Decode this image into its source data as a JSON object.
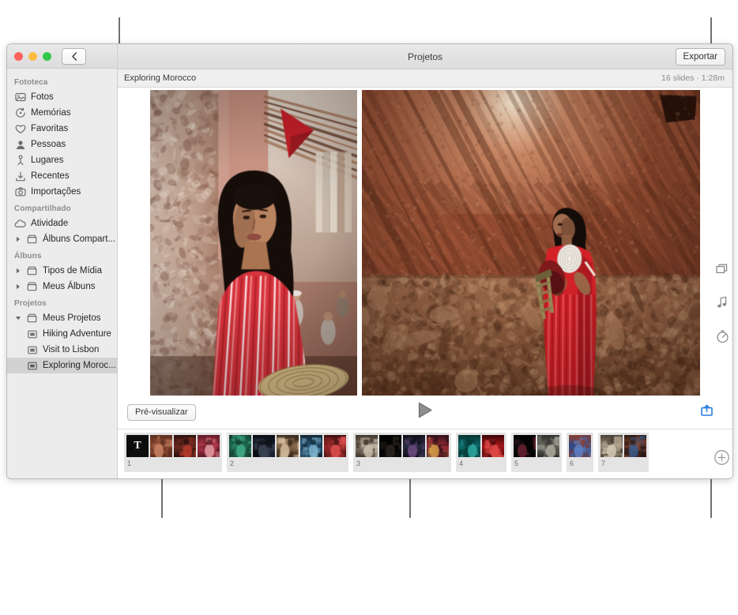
{
  "window": {
    "toolbar_title": "Projetos",
    "export_label": "Exportar",
    "back_icon": "chevron-left-icon"
  },
  "sidebar": {
    "sections": [
      {
        "header": "Fototeca",
        "items": [
          {
            "label": "Fotos",
            "icon": "photos-icon"
          },
          {
            "label": "Memórias",
            "icon": "memories-icon"
          },
          {
            "label": "Favoritas",
            "icon": "heart-icon"
          },
          {
            "label": "Pessoas",
            "icon": "person-icon"
          },
          {
            "label": "Lugares",
            "icon": "pin-icon"
          },
          {
            "label": "Recentes",
            "icon": "download-icon"
          },
          {
            "label": "Importações",
            "icon": "camera-icon"
          }
        ]
      },
      {
        "header": "Compartilhado",
        "items": [
          {
            "label": "Atividade",
            "icon": "cloud-icon"
          },
          {
            "label": "Álbuns Compart...",
            "icon": "folder-icon",
            "disclosure": "collapsed",
            "trailing_icon": "plus-circle-icon"
          }
        ]
      },
      {
        "header": "Álbuns",
        "items": [
          {
            "label": "Tipos de Mídia",
            "icon": "folder-icon",
            "disclosure": "collapsed"
          },
          {
            "label": "Meus Álbuns",
            "icon": "folder-icon",
            "disclosure": "collapsed"
          }
        ]
      },
      {
        "header": "Projetos",
        "items": [
          {
            "label": "Meus Projetos",
            "icon": "folder-icon",
            "disclosure": "expanded"
          },
          {
            "label": "Hiking Adventure",
            "icon": "slideshow-icon",
            "child": true
          },
          {
            "label": "Visit to Lisbon",
            "icon": "slideshow-icon",
            "child": true
          },
          {
            "label": "Exploring Moroc...",
            "icon": "slideshow-icon",
            "child": true,
            "selected": true
          }
        ]
      }
    ]
  },
  "project_bar": {
    "name": "Exploring Morocco",
    "meta": "16 slides · 1:28m"
  },
  "controls": {
    "preview_label": "Pré-visualizar",
    "play_icon": "play-icon",
    "share_icon": "export-share-icon"
  },
  "rail": {
    "icons": [
      {
        "name": "themes-icon"
      },
      {
        "name": "music-note-icon"
      },
      {
        "name": "duration-timer-icon"
      }
    ],
    "add_icon": "plus-circle-icon"
  },
  "filmstrip": {
    "groups": [
      {
        "number": "1",
        "slides": [
          {
            "kind": "title",
            "letter": "T"
          },
          {
            "kind": "photo",
            "palette": [
              "#8a4a33",
              "#c98263",
              "#5d2d1e"
            ]
          },
          {
            "kind": "photo",
            "palette": [
              "#6e2a22",
              "#b33a2c",
              "#2a100c"
            ]
          },
          {
            "kind": "photo",
            "palette": [
              "#b0374a",
              "#e8a0a8",
              "#5b1b27"
            ]
          }
        ]
      },
      {
        "number": "2",
        "slides": [
          {
            "kind": "photo",
            "palette": [
              "#1f6b52",
              "#3fae86",
              "#13372c"
            ]
          },
          {
            "kind": "photo",
            "palette": [
              "#1d2230",
              "#3c4556",
              "#0b0e14"
            ]
          },
          {
            "kind": "photo",
            "palette": [
              "#8a6a4a",
              "#d8c0a0",
              "#3a2a1c"
            ]
          },
          {
            "kind": "photo",
            "palette": [
              "#2a5a7a",
              "#7fb4cf",
              "#122634"
            ]
          },
          {
            "kind": "photo",
            "palette": [
              "#9a2a2a",
              "#e05050",
              "#3a0e0e"
            ]
          }
        ]
      },
      {
        "number": "3",
        "slides": [
          {
            "kind": "photo",
            "palette": [
              "#8f8070",
              "#cdbfae",
              "#3e352c"
            ]
          },
          {
            "kind": "photo",
            "palette": [
              "#101010",
              "#2a2420",
              "#000000"
            ]
          },
          {
            "kind": "photo",
            "palette": [
              "#2a2a40",
              "#6a4a80",
              "#0e0e18"
            ]
          },
          {
            "kind": "photo",
            "palette": [
              "#9b2f35",
              "#d9a04a",
              "#33101a"
            ]
          }
        ]
      },
      {
        "number": "4",
        "slides": [
          {
            "kind": "photo",
            "palette": [
              "#0f6a6a",
              "#2fa8a0",
              "#073434"
            ]
          },
          {
            "kind": "photo",
            "palette": [
              "#a3161c",
              "#e24a46",
              "#3c0608"
            ]
          }
        ]
      },
      {
        "number": "5",
        "slides": [
          {
            "kind": "photo",
            "palette": [
              "#0c0c0c",
              "#6a2230",
              "#000000"
            ]
          },
          {
            "kind": "photo",
            "palette": [
              "#6b6b63",
              "#b0ada0",
              "#2c2c28"
            ]
          }
        ]
      },
      {
        "number": "6",
        "slides": [
          {
            "kind": "photo",
            "palette": [
              "#2a4a8a",
              "#5b7fc4",
              "#8a4032"
            ]
          }
        ]
      },
      {
        "number": "7",
        "slides": [
          {
            "kind": "photo",
            "palette": [
              "#9a8c78",
              "#d8ccb8",
              "#4a4034"
            ]
          },
          {
            "kind": "photo",
            "palette": [
              "#8a4a3a",
              "#3a5a8a",
              "#2a1a14"
            ]
          }
        ]
      }
    ]
  },
  "preview": {
    "slides": [
      {
        "name": "left-photo",
        "alt": "Woman in red striped dress in Marrakech alley"
      },
      {
        "name": "right-photo",
        "alt": "Woman in red kaftan against sunlit clay wall"
      }
    ]
  },
  "colors": {
    "accent_blue": "#2b7fe0",
    "sidebar_bg": "#ececec",
    "selection": "#d2d2d2",
    "callout": "#707070"
  }
}
